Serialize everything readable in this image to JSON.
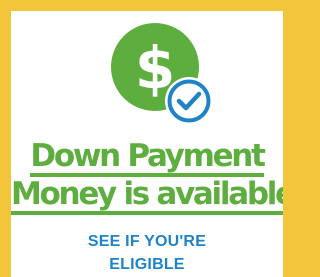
{
  "ad": {
    "icon": "dollar-check-badge-icon",
    "headline_line1": "Down Payment",
    "headline_line2": "Money is available",
    "cta_line1": "SEE IF YOU'RE",
    "cta_line2": "ELIGIBLE"
  },
  "colors": {
    "frame": "#F2C53A",
    "background": "#FFFFFF",
    "headline": "#5DAE3F",
    "cta": "#1E84C6",
    "check": "#1E84C6"
  }
}
